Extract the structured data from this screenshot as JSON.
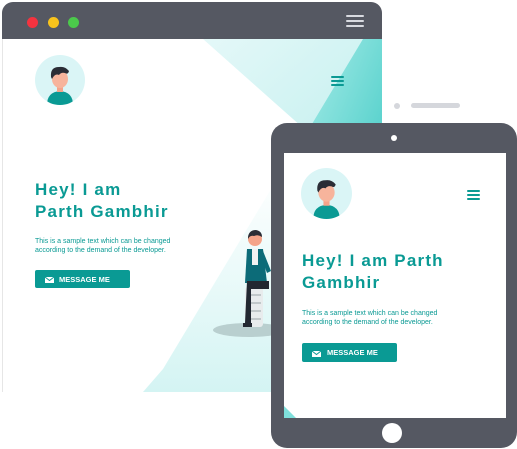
{
  "colors": {
    "accent": "#0a9a94",
    "frame": "#555862",
    "teal_light": "#7fe0dc",
    "avatar_bg": "#daf5f6"
  },
  "desktop": {
    "window_controls": [
      "close",
      "minimize",
      "maximize"
    ],
    "heading_line1": "Hey! I am",
    "heading_line2": "Parth Gambhir",
    "description": "This is a sample text which can be changed according to the demand of the developer.",
    "button_label": "MESSAGE ME"
  },
  "tablet": {
    "heading_line1": "Hey! I am Parth",
    "heading_line2": "Gambhir",
    "description": "This is a sample text which can be changed according to the demand of the developer.",
    "button_label": "MESSAGE ME"
  },
  "icons": {
    "menu": "hamburger-icon",
    "mail": "mail-icon",
    "avatar": "avatar"
  }
}
